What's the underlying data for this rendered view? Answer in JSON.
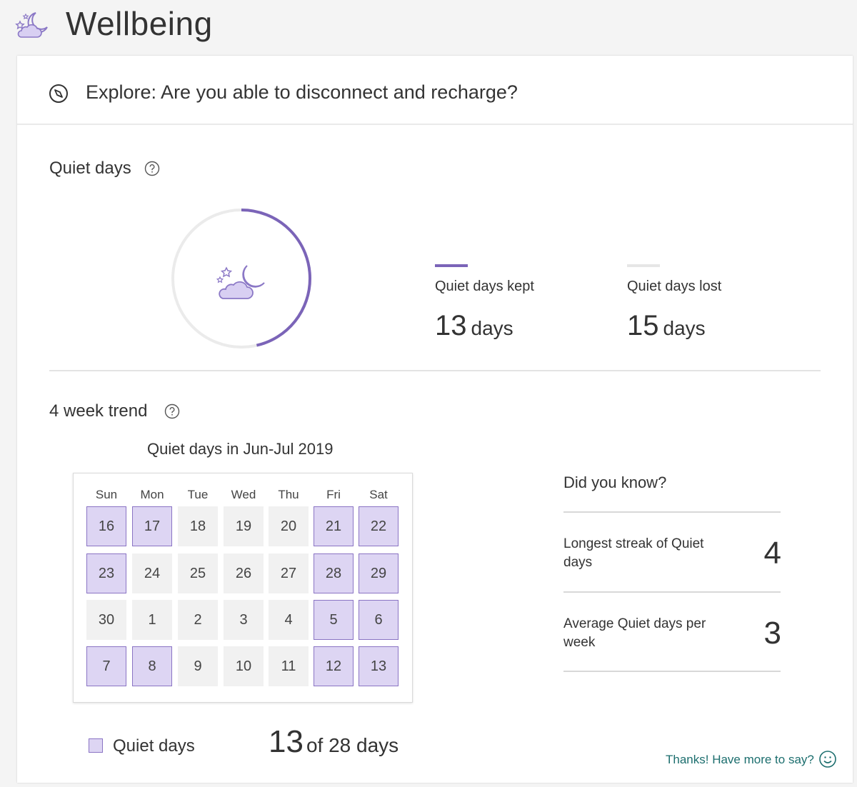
{
  "header": {
    "title": "Wellbeing",
    "icon": "moon-cloud-icon"
  },
  "explore": {
    "text": "Explore: Are you able to disconnect and recharge?",
    "icon": "compass-icon"
  },
  "quiet_days": {
    "title": "Quiet days",
    "kept_fraction": 0.464,
    "kept": {
      "label": "Quiet days kept",
      "value": "13",
      "unit": "days",
      "color": "#7b64b8"
    },
    "lost": {
      "label": "Quiet days lost",
      "value": "15",
      "unit": "days",
      "color": "#e6e6e6"
    }
  },
  "trend": {
    "title": "4 week trend",
    "calendar_title": "Quiet days in Jun-Jul 2019",
    "weekdays": [
      "Sun",
      "Mon",
      "Tue",
      "Wed",
      "Thu",
      "Fri",
      "Sat"
    ],
    "weeks": [
      [
        {
          "d": "16",
          "q": true
        },
        {
          "d": "17",
          "q": true
        },
        {
          "d": "18",
          "q": false
        },
        {
          "d": "19",
          "q": false
        },
        {
          "d": "20",
          "q": false
        },
        {
          "d": "21",
          "q": true
        },
        {
          "d": "22",
          "q": true
        }
      ],
      [
        {
          "d": "23",
          "q": true
        },
        {
          "d": "24",
          "q": false
        },
        {
          "d": "25",
          "q": false
        },
        {
          "d": "26",
          "q": false
        },
        {
          "d": "27",
          "q": false
        },
        {
          "d": "28",
          "q": true
        },
        {
          "d": "29",
          "q": true
        }
      ],
      [
        {
          "d": "30",
          "q": false
        },
        {
          "d": "1",
          "q": false
        },
        {
          "d": "2",
          "q": false
        },
        {
          "d": "3",
          "q": false
        },
        {
          "d": "4",
          "q": false
        },
        {
          "d": "5",
          "q": true
        },
        {
          "d": "6",
          "q": true
        }
      ],
      [
        {
          "d": "7",
          "q": true
        },
        {
          "d": "8",
          "q": true
        },
        {
          "d": "9",
          "q": false
        },
        {
          "d": "10",
          "q": false
        },
        {
          "d": "11",
          "q": false
        },
        {
          "d": "12",
          "q": true
        },
        {
          "d": "13",
          "q": true
        }
      ]
    ],
    "legend_label": "Quiet days",
    "total_count": "13",
    "total_rest": "of 28 days"
  },
  "did_you_know": {
    "title": "Did you know?",
    "facts": [
      {
        "label": "Longest streak of Quiet days",
        "value": "4"
      },
      {
        "label": "Average Quiet days per week",
        "value": "3"
      }
    ]
  },
  "feedback": {
    "text": "Thanks! Have more to say?",
    "icon": "smile-icon"
  },
  "colors": {
    "accent": "#7b64b8",
    "quiet_fill": "#ddd5f3",
    "feedback": "#1c6e6e"
  }
}
